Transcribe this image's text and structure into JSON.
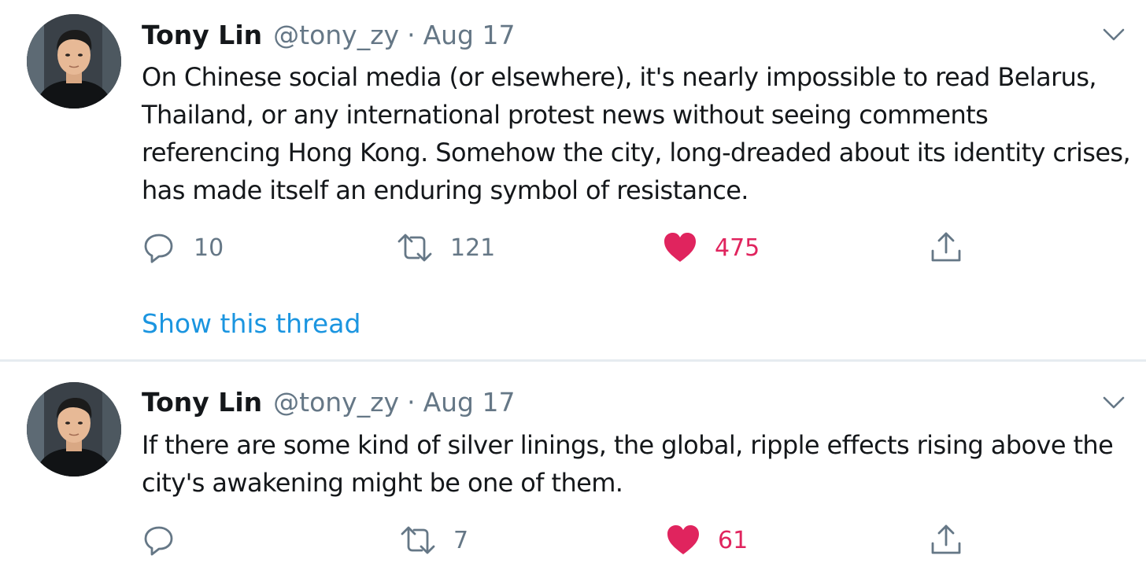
{
  "tweets": [
    {
      "name": "Tony Lin",
      "handle": "@tony_zy",
      "separator": "·",
      "date": "Aug 17",
      "text": "On Chinese social media (or elsewhere), it's nearly impossible to read Belarus, Thailand, or any international protest news without seeing comments referencing Hong Kong. Somehow the city, long-dreaded about its identity crises, has made itself an enduring symbol of resistance.",
      "replies": "10",
      "retweets": "121",
      "likes": "475",
      "liked": true,
      "show_thread": "Show this thread"
    },
    {
      "name": "Tony Lin",
      "handle": "@tony_zy",
      "separator": "·",
      "date": "Aug 17",
      "text": "If there are some kind of silver linings, the global, ripple effects rising above the city's awakening might be one of them.",
      "replies": "",
      "retweets": "7",
      "likes": "61",
      "liked": true
    }
  ],
  "icons": {
    "reply": "reply-icon",
    "retweet": "retweet-icon",
    "like": "heart-icon",
    "share": "share-icon",
    "caret": "chevron-down-icon"
  },
  "colors": {
    "text": "#14171a",
    "secondary": "#657786",
    "like": "#e0245e",
    "link": "#1b95e0",
    "divider": "#e6ecf0"
  }
}
